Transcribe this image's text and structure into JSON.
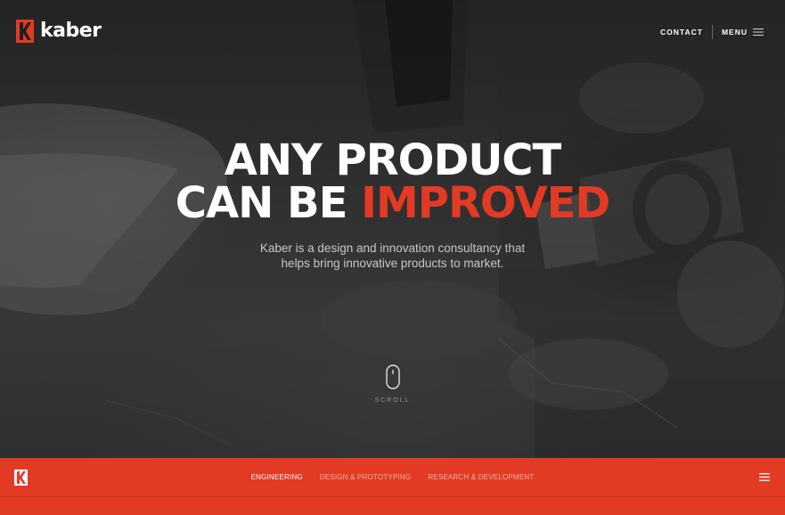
{
  "brand": {
    "name": "kaber",
    "accent_color": "#e33a24"
  },
  "header": {
    "contact_label": "CONTACT",
    "menu_label": "MENU",
    "menu_icon": "hamburger-icon"
  },
  "hero": {
    "headline_line1": "ANY PRODUCT",
    "headline_line2_prefix": "CAN BE ",
    "headline_line2_accent": "IMPROVED",
    "subhead_line1": "Kaber is a design and innovation consultancy that",
    "subhead_line2": "helps bring innovative products to market.",
    "scroll_label": "SCROLL",
    "scroll_icon": "mouse-icon"
  },
  "subnav": {
    "logo_icon": "kaber-k-icon",
    "items": [
      {
        "label": "Engineering",
        "active": true
      },
      {
        "label": "Design & Prototyping",
        "active": false
      },
      {
        "label": "Research & Development",
        "active": false
      }
    ],
    "menu_icon": "hamburger-icon"
  }
}
